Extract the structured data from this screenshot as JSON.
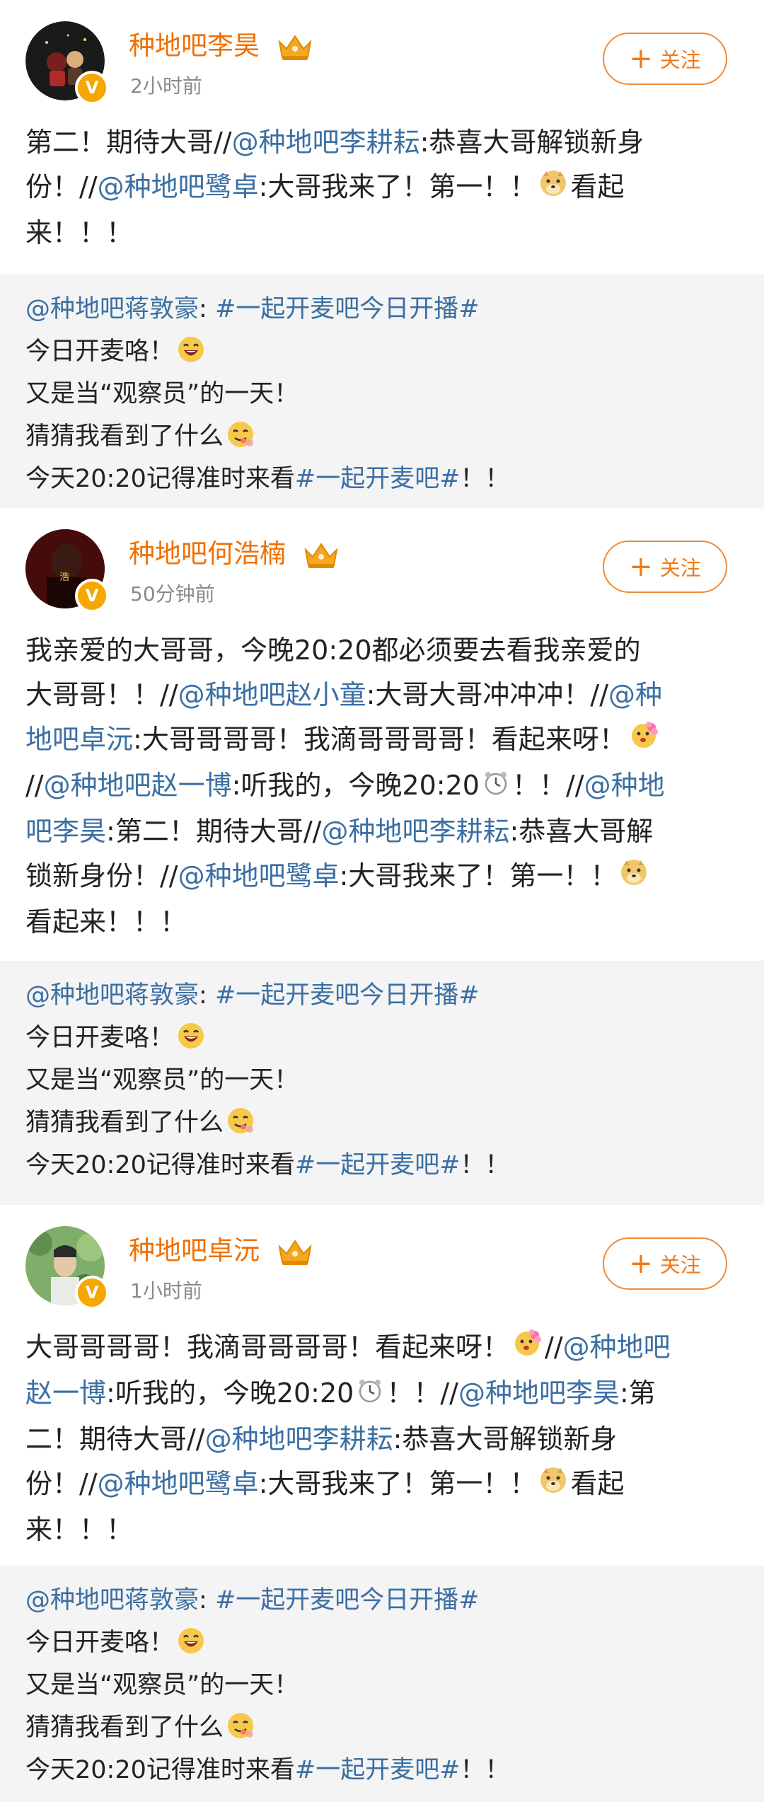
{
  "follow_label": "关注",
  "posts": [
    {
      "name": "种地吧李昊",
      "time": "2小时前",
      "lines": [
        [
          {
            "t": "第二！期待大哥//"
          },
          {
            "m": "@种地吧李耕耘"
          },
          {
            "t": ":恭喜大哥解锁新身"
          }
        ],
        [
          {
            "t": "份！//"
          },
          {
            "m": "@种地吧鹭卓"
          },
          {
            "t": ":大哥我来了！第一！！"
          },
          {
            "e": "doge"
          },
          {
            "t": "看起"
          }
        ],
        [
          {
            "t": "来！！！"
          }
        ]
      ]
    },
    {
      "name": "种地吧何浩楠",
      "time": "50分钟前",
      "lines": [
        [
          {
            "t": "我亲爱的大哥哥，今晚20:20都必须要去看我亲爱的"
          }
        ],
        [
          {
            "t": "大哥哥！！//"
          },
          {
            "m": "@种地吧赵小童"
          },
          {
            "t": ":大哥大哥冲冲冲！//"
          },
          {
            "m": "@种"
          }
        ],
        [
          {
            "m": "地吧卓沅"
          },
          {
            "t": ":大哥哥哥哥！我滴哥哥哥哥！看起来呀！"
          },
          {
            "e": "flower"
          }
        ],
        [
          {
            "t": "//"
          },
          {
            "m": "@种地吧赵一博"
          },
          {
            "t": ":听我的，今晚20:20"
          },
          {
            "e": "clock"
          },
          {
            "t": "！！//"
          },
          {
            "m": "@种地"
          }
        ],
        [
          {
            "m": "吧李昊"
          },
          {
            "t": ":第二！期待大哥//"
          },
          {
            "m": "@种地吧李耕耘"
          },
          {
            "t": ":恭喜大哥解"
          }
        ],
        [
          {
            "t": "锁新身份！//"
          },
          {
            "m": "@种地吧鹭卓"
          },
          {
            "t": ":大哥我来了！第一！！"
          },
          {
            "e": "doge"
          }
        ],
        [
          {
            "t": "看起来！！！"
          }
        ]
      ]
    },
    {
      "name": "种地吧卓沅",
      "time": "1小时前",
      "lines": [
        [
          {
            "t": "大哥哥哥哥！我滴哥哥哥哥！看起来呀！"
          },
          {
            "e": "flower"
          },
          {
            "t": "//"
          },
          {
            "m": "@种地吧"
          }
        ],
        [
          {
            "m": "赵一博"
          },
          {
            "t": ":听我的，今晚20:20"
          },
          {
            "e": "clock"
          },
          {
            "t": "！！//"
          },
          {
            "m": "@种地吧李昊"
          },
          {
            "t": ":第"
          }
        ],
        [
          {
            "t": "二！期待大哥//"
          },
          {
            "m": "@种地吧李耕耘"
          },
          {
            "t": ":恭喜大哥解锁新身"
          }
        ],
        [
          {
            "t": "份！//"
          },
          {
            "m": "@种地吧鹭卓"
          },
          {
            "t": ":大哥我来了！第一！！"
          },
          {
            "e": "doge"
          },
          {
            "t": "看起"
          }
        ],
        [
          {
            "t": "来！！！"
          }
        ]
      ]
    }
  ],
  "repost": {
    "lines": [
      [
        {
          "m": "@种地吧蒋敦豪"
        },
        {
          "t": ": "
        },
        {
          "m": "#一起开麦吧今日开播#"
        }
      ],
      [
        {
          "t": "今日开麦咯！"
        },
        {
          "e": "laugh"
        }
      ],
      [
        {
          "t": "又是当“观察员”的一天！"
        }
      ],
      [
        {
          "t": "猜猜我看到了什么"
        },
        {
          "e": "yum"
        }
      ],
      [
        {
          "t": "今天20:20记得准时来看"
        },
        {
          "m": "#一起开麦吧#"
        },
        {
          "t": "！！"
        }
      ]
    ]
  }
}
